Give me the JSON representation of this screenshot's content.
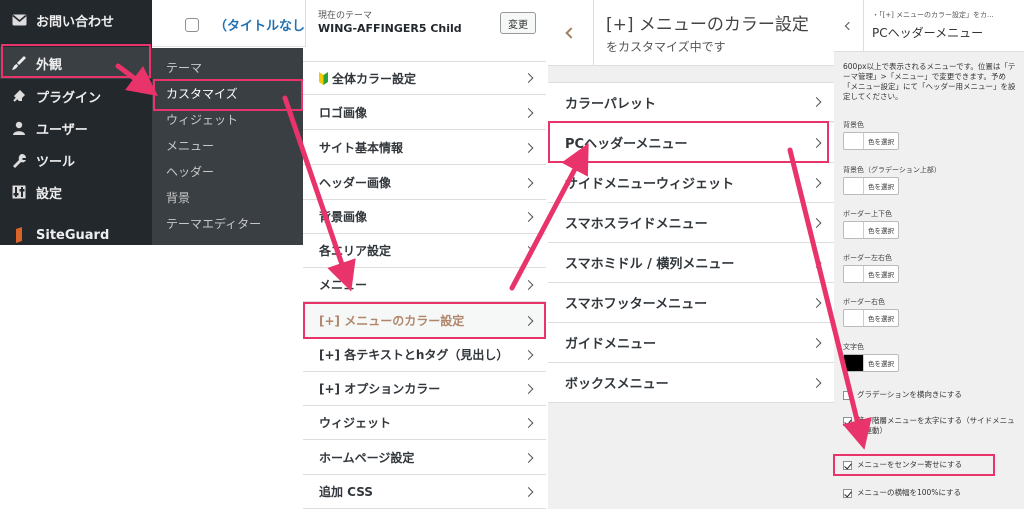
{
  "wp_nav": {
    "items": [
      {
        "label": "お問い合わせ",
        "icon": "mail-icon"
      },
      {
        "label": "外観",
        "icon": "brush-icon"
      },
      {
        "label": "プラグイン",
        "icon": "plugin-icon"
      },
      {
        "label": "ユーザー",
        "icon": "user-icon"
      },
      {
        "label": "ツール",
        "icon": "wrench-icon"
      },
      {
        "label": "設定",
        "icon": "settings-icon"
      },
      {
        "label": "SiteGuard",
        "icon": "siteguard-icon"
      }
    ]
  },
  "appearance_submenu": [
    "テーマ",
    "カスタマイズ",
    "ウィジェット",
    "メニュー",
    "ヘッダー",
    "背景",
    "テーマエディター"
  ],
  "posts_row": {
    "title": "（タイトルなし）"
  },
  "customizer": {
    "theme_label": "現在のテーマ",
    "theme_name": "WING-AFFINGER5 Child",
    "change_button": "変更",
    "menu": [
      "全体カラー設定",
      "ロゴ画像",
      "サイト基本情報",
      "ヘッダー画像",
      "背景画像",
      "各エリア設定",
      "メニュー",
      "[+] メニューのカラー設定",
      "[+] 各テキストとhタグ（見出し）",
      "[+] オプションカラー",
      "ウィジェット",
      "ホームページ設定",
      "追加 CSS"
    ]
  },
  "section": {
    "title": "[+] メニューのカラー設定",
    "subtitle": "をカスタマイズ中です",
    "items": [
      "カラーパレット",
      "PCヘッダーメニュー",
      "サイドメニューウィジェット",
      "スマホスライドメニュー",
      "スマホミドル / 横列メニュー",
      "スマホフッターメニュー",
      "ガイドメニュー",
      "ボックスメニュー"
    ]
  },
  "pc_panel": {
    "breadcrumb": "・「[+] メニューのカラー設定」をカ...",
    "title": "PCヘッダーメニュー",
    "description": "600px以上で表示されるメニューです。位置は「テーマ管理」>「メニュー」で変更できます。予め「メニュー設定」にて「ヘッダー用メニュー」を設定してください。",
    "select_label": "色を選択",
    "colors": [
      {
        "label": "背景色",
        "swatch": "#ffffff"
      },
      {
        "label": "背景色（グラデーション上部）",
        "swatch": "#ffffff"
      },
      {
        "label": "ボーダー上下色",
        "swatch": "#ffffff"
      },
      {
        "label": "ボーダー左右色",
        "swatch": "#ffffff"
      },
      {
        "label": "ボーダー右色",
        "swatch": "#ffffff"
      },
      {
        "label": "文字色",
        "swatch": "#000000"
      }
    ],
    "checks": [
      {
        "label": "グラデーションを横向きにする",
        "checked": false
      },
      {
        "label": "第一階層メニューを太字にする（サイドメニュー連動）",
        "checked": true
      },
      {
        "label": "メニューをセンター寄せにする",
        "checked": true
      },
      {
        "label": "メニューの横幅を100%にする",
        "checked": true
      }
    ]
  },
  "colors": {
    "highlight": "#e8336b",
    "nav_bg": "#23282d",
    "submenu_bg": "#3a3f44",
    "accent_text": "#b1876b"
  }
}
